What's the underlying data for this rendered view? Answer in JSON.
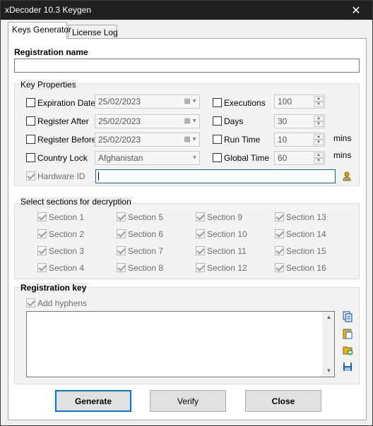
{
  "window": {
    "title": "xDecoder 10.3 Keygen",
    "close_glyph": "✕"
  },
  "tabs": [
    {
      "label": "Keys Generator"
    },
    {
      "label": "License Log"
    }
  ],
  "registration_name": {
    "label": "Registration name",
    "value": ""
  },
  "key_properties": {
    "title": "Key Properties",
    "expiration_date": {
      "label": "Expiration Date",
      "value": "25/02/2023",
      "checked": false
    },
    "register_after": {
      "label": "Register After",
      "value": "25/02/2023",
      "checked": false
    },
    "register_before": {
      "label": "Register Before",
      "value": "25/02/2023",
      "checked": false
    },
    "country_lock": {
      "label": "Country Lock",
      "value": "Afghanistan",
      "checked": false
    },
    "hardware_id": {
      "label": "Hardware ID",
      "value": "",
      "checked": true
    },
    "executions": {
      "label": "Executions",
      "value": "100",
      "checked": false
    },
    "days": {
      "label": "Days",
      "value": "30",
      "checked": false
    },
    "run_time": {
      "label": "Run Time",
      "value": "10",
      "unit": "mins",
      "checked": false
    },
    "global_time": {
      "label": "Global Time",
      "value": "60",
      "unit": "mins",
      "checked": false
    }
  },
  "sections": {
    "title": "Select sections for decryption",
    "items": [
      "Section 1",
      "Section 2",
      "Section 3",
      "Section 4",
      "Section 5",
      "Section 6",
      "Section 7",
      "Section 8",
      "Section 9",
      "Section 10",
      "Section 11",
      "Section 12",
      "Section 13",
      "Section 14",
      "Section 15",
      "Section 16"
    ]
  },
  "registration_key": {
    "title": "Registration key",
    "add_hyphens": "Add hyphens",
    "value": ""
  },
  "buttons": {
    "generate": "Generate",
    "verify": "Verify",
    "close": "Close"
  },
  "colors": {
    "accent": "#0078d7",
    "titlebar": "#202020",
    "icon_blue": "#2a62b8",
    "icon_yellow": "#e8b21c",
    "icon_green": "#3aa63a"
  }
}
